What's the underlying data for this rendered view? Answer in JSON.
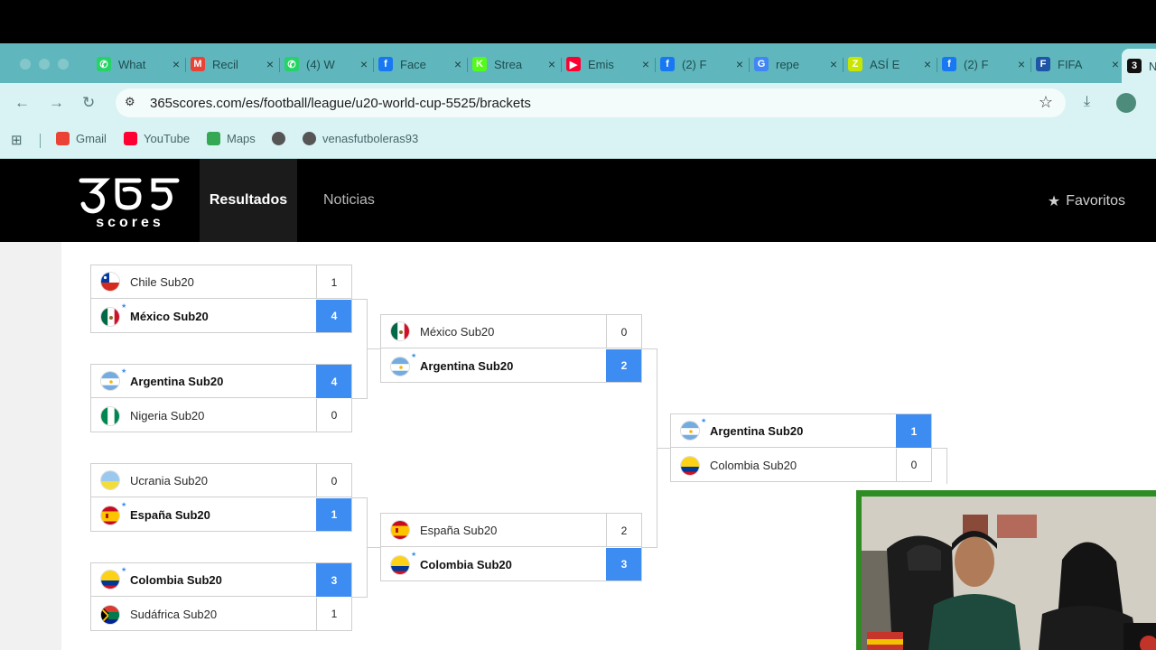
{
  "browser": {
    "tabs": [
      {
        "title": "What",
        "icon": "whatsapp-icon",
        "color": "#25d366",
        "glyph": "✆"
      },
      {
        "title": "Recil",
        "icon": "gmail-icon",
        "color": "#ea4335",
        "glyph": "M"
      },
      {
        "title": "(4) W",
        "icon": "whatsapp-icon",
        "color": "#25d366",
        "glyph": "✆"
      },
      {
        "title": "Face",
        "icon": "facebook-icon",
        "color": "#1877f2",
        "glyph": "f"
      },
      {
        "title": "Strea",
        "icon": "kick-icon",
        "color": "#53fc18",
        "glyph": "K"
      },
      {
        "title": "Emis",
        "icon": "youtube-icon",
        "color": "#ff0033",
        "glyph": "▶"
      },
      {
        "title": "(2) F",
        "icon": "facebook-icon",
        "color": "#1877f2",
        "glyph": "f"
      },
      {
        "title": "repe",
        "icon": "google-icon",
        "color": "#4285f4",
        "glyph": "G"
      },
      {
        "title": "ASÍ E",
        "icon": "zeta-icon",
        "color": "#c8e600",
        "glyph": "Z"
      },
      {
        "title": "(2) F",
        "icon": "facebook-icon",
        "color": "#1877f2",
        "glyph": "f"
      },
      {
        "title": "FIFA",
        "icon": "fifa-icon",
        "color": "#1f55a6",
        "glyph": "F"
      },
      {
        "title": "N",
        "icon": "365scores-icon",
        "color": "#111111",
        "glyph": "3"
      }
    ],
    "url": "365scores.com/es/football/league/u20-world-cup-5525/brackets",
    "bookmarks": [
      {
        "label": "Gmail",
        "icon": "gmail-icon",
        "color": "#ea4335"
      },
      {
        "label": "YouTube",
        "icon": "youtube-icon",
        "color": "#ff0033"
      },
      {
        "label": "Maps",
        "icon": "maps-icon",
        "color": "#34a853"
      },
      {
        "label": "",
        "icon": "globe-icon",
        "color": "#555555"
      },
      {
        "label": "venasfutboleras93",
        "icon": "globe-icon",
        "color": "#555555"
      }
    ]
  },
  "site": {
    "nav_results": "Resultados",
    "nav_news": "Noticias",
    "favorites": "Favoritos"
  },
  "bracket": {
    "round1": [
      {
        "home": {
          "name": "Chile Sub20",
          "score": "1",
          "flag": "chile",
          "win": false,
          "fav": false
        },
        "away": {
          "name": "México Sub20",
          "score": "4",
          "flag": "mexico",
          "win": true,
          "fav": true
        }
      },
      {
        "home": {
          "name": "Argentina Sub20",
          "score": "4",
          "flag": "argentina",
          "win": true,
          "fav": true
        },
        "away": {
          "name": "Nigeria Sub20",
          "score": "0",
          "flag": "nigeria",
          "win": false,
          "fav": false
        }
      },
      {
        "home": {
          "name": "Ucrania Sub20",
          "score": "0",
          "flag": "ukraine",
          "win": false,
          "fav": false
        },
        "away": {
          "name": "España Sub20",
          "score": "1",
          "flag": "spain",
          "win": true,
          "fav": true
        }
      },
      {
        "home": {
          "name": "Colombia Sub20",
          "score": "3",
          "flag": "colombia",
          "win": true,
          "fav": true
        },
        "away": {
          "name": "Sudáfrica Sub20",
          "score": "1",
          "flag": "southafrica",
          "win": false,
          "fav": false
        }
      }
    ],
    "round2": [
      {
        "home": {
          "name": "México Sub20",
          "score": "0",
          "flag": "mexico",
          "win": false,
          "fav": false
        },
        "away": {
          "name": "Argentina Sub20",
          "score": "2",
          "flag": "argentina",
          "win": true,
          "fav": true
        }
      },
      {
        "home": {
          "name": "España Sub20",
          "score": "2",
          "flag": "spain",
          "win": false,
          "fav": false
        },
        "away": {
          "name": "Colombia Sub20",
          "score": "3",
          "flag": "colombia",
          "win": true,
          "fav": true
        }
      }
    ],
    "round3": [
      {
        "home": {
          "name": "Argentina Sub20",
          "score": "1",
          "flag": "argentina",
          "win": true,
          "fav": true
        },
        "away": {
          "name": "Colombia Sub20",
          "score": "0",
          "flag": "colombia",
          "win": false,
          "fav": false
        }
      }
    ]
  },
  "colors": {
    "accent": "#3d8cf1",
    "header": "#000000",
    "chrome": "#5fb7bd"
  }
}
